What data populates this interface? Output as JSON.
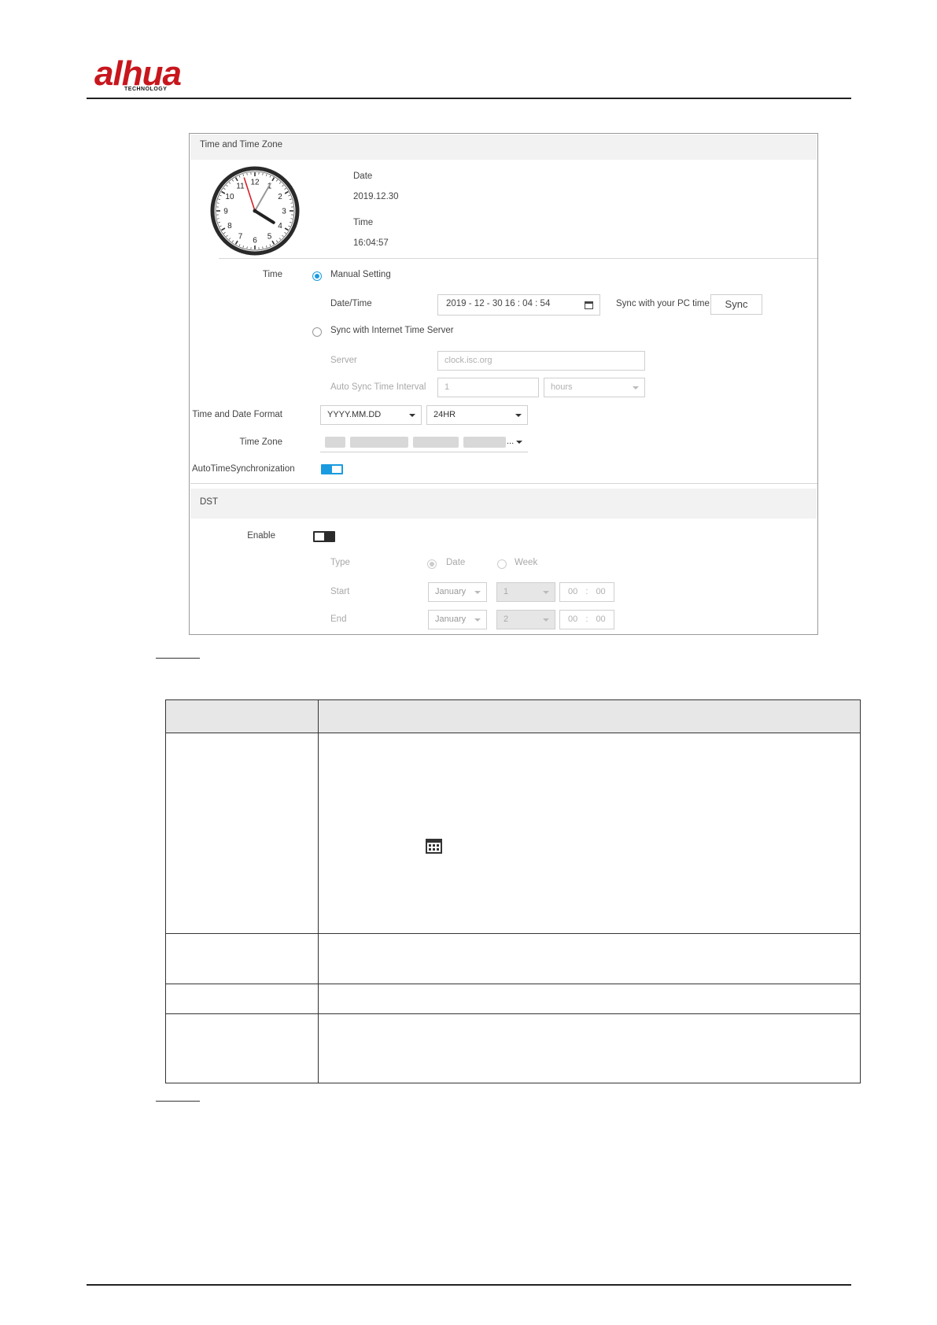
{
  "header": {
    "logo_text": "alhua",
    "logo_sub": "TECHNOLOGY"
  },
  "time_zone_section": {
    "title": "Time and Time Zone",
    "clock": {
      "numerals": [
        "12",
        "1",
        "2",
        "3",
        "4",
        "5",
        "6",
        "7",
        "8",
        "9",
        "10",
        "11"
      ],
      "hour": 16,
      "minute": 4,
      "second": 57
    },
    "date_label": "Date",
    "date_value": "2019.12.30",
    "time_label": "Time",
    "time_value": "16:04:57"
  },
  "form": {
    "time_label": "Time",
    "manual_setting": "Manual Setting",
    "datetime_label": "Date/Time",
    "datetime_value": "2019 - 12 - 30  16 : 04 : 54",
    "sync_pc_label": "Sync with your PC time",
    "sync_button": "Sync",
    "sync_internet": "Sync with Internet Time Server",
    "server_label": "Server",
    "server_value": "clock.isc.org",
    "interval_label": "Auto Sync Time Interval",
    "interval_value": "1",
    "interval_unit": "hours",
    "format_label": "Time and Date Format",
    "date_format": "YYYY.MM.DD",
    "hour_format": "24HR",
    "timezone_label": "Time Zone",
    "timezone_ellipsis": "...",
    "auto_sync_label": "AutoTimeSynchronization",
    "auto_sync_on": true
  },
  "dst": {
    "title": "DST",
    "enable_label": "Enable",
    "enable_on": false,
    "type_label": "Type",
    "type_date": "Date",
    "type_week": "Week",
    "start_label": "Start",
    "start_month": "January",
    "start_day": "1",
    "start_hh": "00",
    "start_mm": "00",
    "end_label": "End",
    "end_month": "January",
    "end_day": "2",
    "end_hh": "00",
    "end_mm": "00",
    "time_sep": ":"
  }
}
